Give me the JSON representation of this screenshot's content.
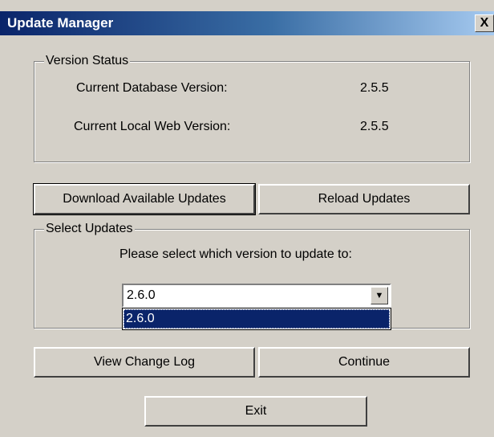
{
  "window": {
    "title": "Update Manager",
    "close_glyph": "X"
  },
  "version_status": {
    "legend": "Version Status",
    "db_label": "Current Database Version:",
    "db_value": "2.5.5",
    "web_label": "Current Local Web Version:",
    "web_value": "2.5.5"
  },
  "actions": {
    "download_label": "Download Available Updates",
    "reload_label": "Reload Updates"
  },
  "select_updates": {
    "legend": "Select Updates",
    "prompt": "Please select which version to update to:",
    "selected_value": "2.6.0",
    "arrow_glyph": "▼",
    "options": [
      "2.6.0"
    ]
  },
  "footer": {
    "changelog_label": "View Change Log",
    "continue_label": "Continue",
    "exit_label": "Exit"
  },
  "colors": {
    "title_gradient_start": "#0a246a",
    "window_face": "#d4d0c8",
    "selection": "#0a246a"
  }
}
